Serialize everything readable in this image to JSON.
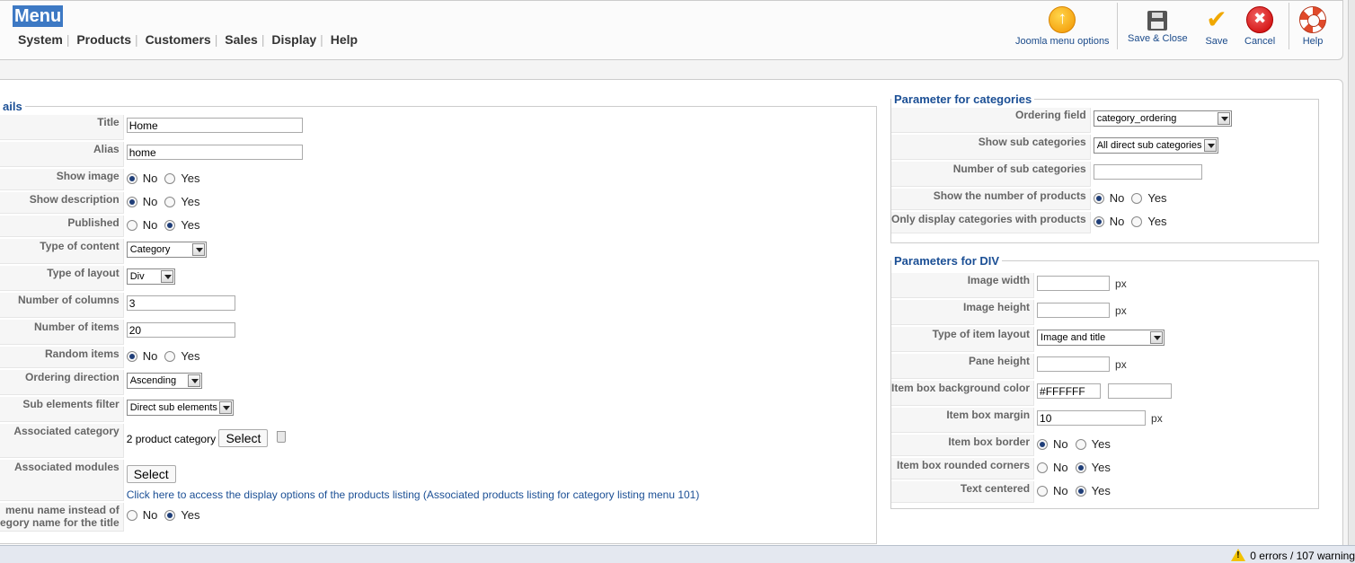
{
  "header": {
    "title": "Menu",
    "menu": [
      "System",
      "Products",
      "Customers",
      "Sales",
      "Display",
      "Help"
    ]
  },
  "toolbar": {
    "joomla_options": "Joomla menu options",
    "save_close": "Save & Close",
    "save": "Save",
    "cancel": "Cancel",
    "help": "Help"
  },
  "details": {
    "legend": "ails",
    "title_label": "Title",
    "title_value": "Home",
    "alias_label": "Alias",
    "alias_value": "home",
    "show_image_label": "Show image",
    "show_description_label": "Show description",
    "published_label": "Published",
    "type_of_content_label": "Type of content",
    "type_of_content_value": "Category",
    "type_of_layout_label": "Type of layout",
    "type_of_layout_value": "Div",
    "number_of_columns_label": "Number of columns",
    "number_of_columns_value": "3",
    "number_of_items_label": "Number of items",
    "number_of_items_value": "20",
    "random_items_label": "Random items",
    "ordering_direction_label": "Ordering direction",
    "ordering_direction_value": "Ascending",
    "sub_elements_filter_label": "Sub elements filter",
    "sub_elements_filter_value": "Direct sub elements",
    "associated_category_label": "Associated category",
    "associated_category_value": "2 product category",
    "associated_modules_label": "Associated modules",
    "select_label": "Select",
    "listing_link": "Click here to access the display options of the products listing (Associated products listing for category listing menu 101)",
    "menu_name_label_line1": "menu name instead of",
    "menu_name_label_line2": "egory name for the title",
    "no": "No",
    "yes": "Yes"
  },
  "categories": {
    "legend": "Parameter for categories",
    "ordering_field_label": "Ordering field",
    "ordering_field_value": "category_ordering",
    "show_sub_label": "Show sub categories",
    "show_sub_value": "All direct sub categories",
    "number_sub_label": "Number of sub categories",
    "show_number_products_label": "Show the number of products",
    "only_with_products_label": "Only display categories with products"
  },
  "div_params": {
    "legend": "Parameters for DIV",
    "image_width_label": "Image width",
    "image_height_label": "Image height",
    "item_layout_label": "Type of item layout",
    "item_layout_value": "Image and title",
    "pane_height_label": "Pane height",
    "bg_color_label": "Item box background color",
    "bg_color_value": "#FFFFFF",
    "margin_label": "Item box margin",
    "margin_value": "10",
    "border_label": "Item box border",
    "rounded_label": "Item box rounded corners",
    "centered_label": "Text centered",
    "unit": "px"
  },
  "status": {
    "text": "0 errors / 107 warning"
  },
  "colors": {
    "title_bg": "#3d79c4",
    "legend": "#1b4f95",
    "link": "#1b4f95"
  }
}
